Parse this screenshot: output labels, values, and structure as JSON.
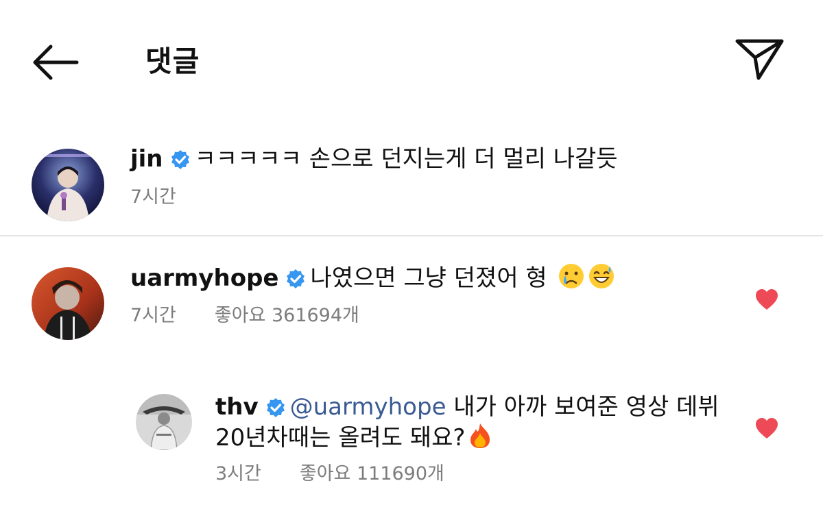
{
  "header": {
    "title": "댓글",
    "back_icon": "back-arrow-icon",
    "share_icon": "paper-plane-icon"
  },
  "comments": [
    {
      "username": "jin",
      "verified": true,
      "text": "ㅋㅋㅋㅋㅋ 손으로 던지는게 더 멀리 나갈듯",
      "time": "7시간",
      "likes": ""
    },
    {
      "username": "uarmyhope",
      "verified": true,
      "text": "나였으면 그냥 던졌어 형",
      "emojis": [
        "crying-face-emoji",
        "grinning-sweat-face-emoji"
      ],
      "time": "7시간",
      "likes": "좋아요 361694개",
      "liked": true
    }
  ],
  "reply": {
    "username": "thv",
    "verified": true,
    "mention": "@uarmyhope",
    "text_line1": "내가 아까 보여준 영상 데뷔",
    "text_line2": "20년차때는 올려도 돼요?",
    "emoji": "fire-emoji",
    "time": "3시간",
    "likes": "좋아요 111690개",
    "liked": true
  },
  "colors": {
    "verified": "#3797f0",
    "heart": "#ed4956",
    "mention": "#3a5a93",
    "meta": "#7c7c7c",
    "divider": "#e3e3e3"
  }
}
